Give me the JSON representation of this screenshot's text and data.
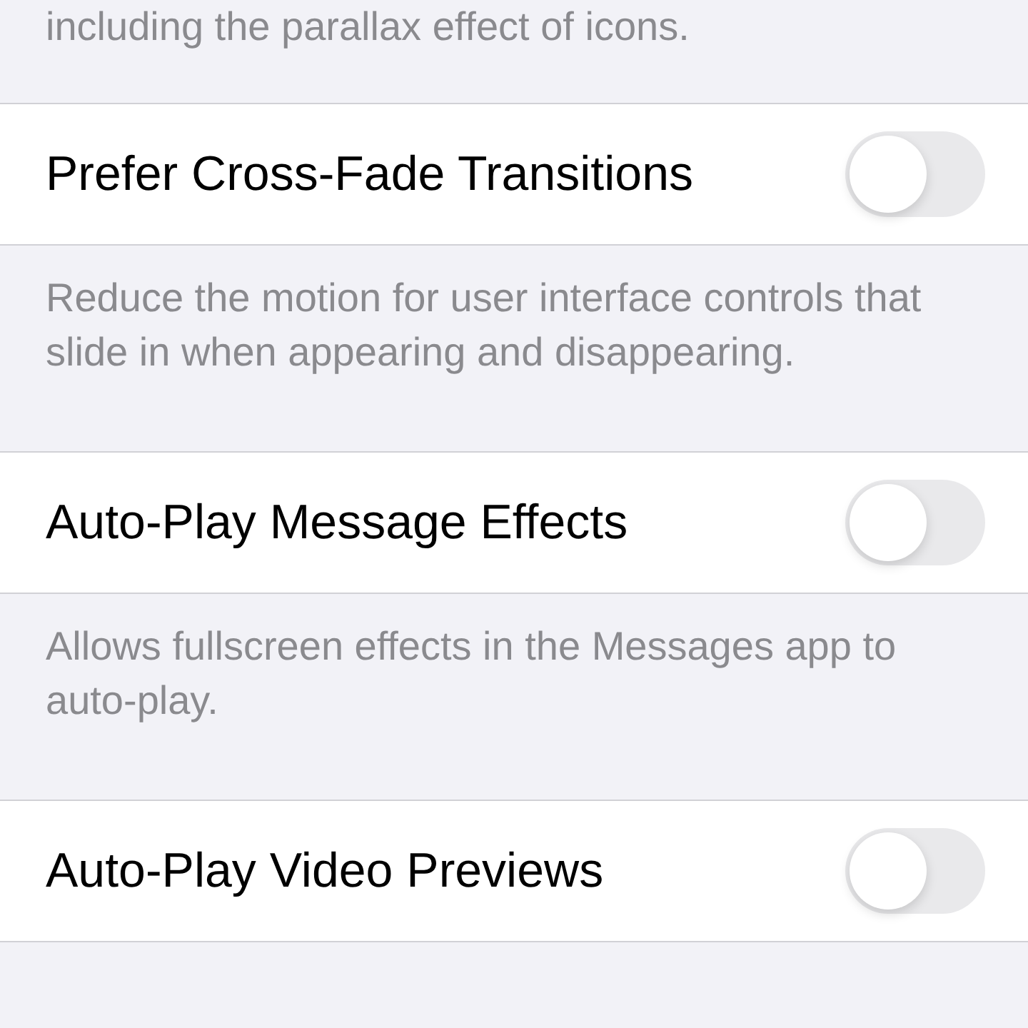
{
  "top_note": "including the parallax effect of icons.",
  "settings": [
    {
      "label": "Prefer Cross-Fade Transitions",
      "on": false,
      "footer": "Reduce the motion for user interface controls that slide in when appearing and disappearing."
    },
    {
      "label": "Auto-Play Message Effects",
      "on": false,
      "footer": "Allows fullscreen effects in the Messages app to auto-play."
    },
    {
      "label": "Auto-Play Video Previews",
      "on": false
    }
  ]
}
